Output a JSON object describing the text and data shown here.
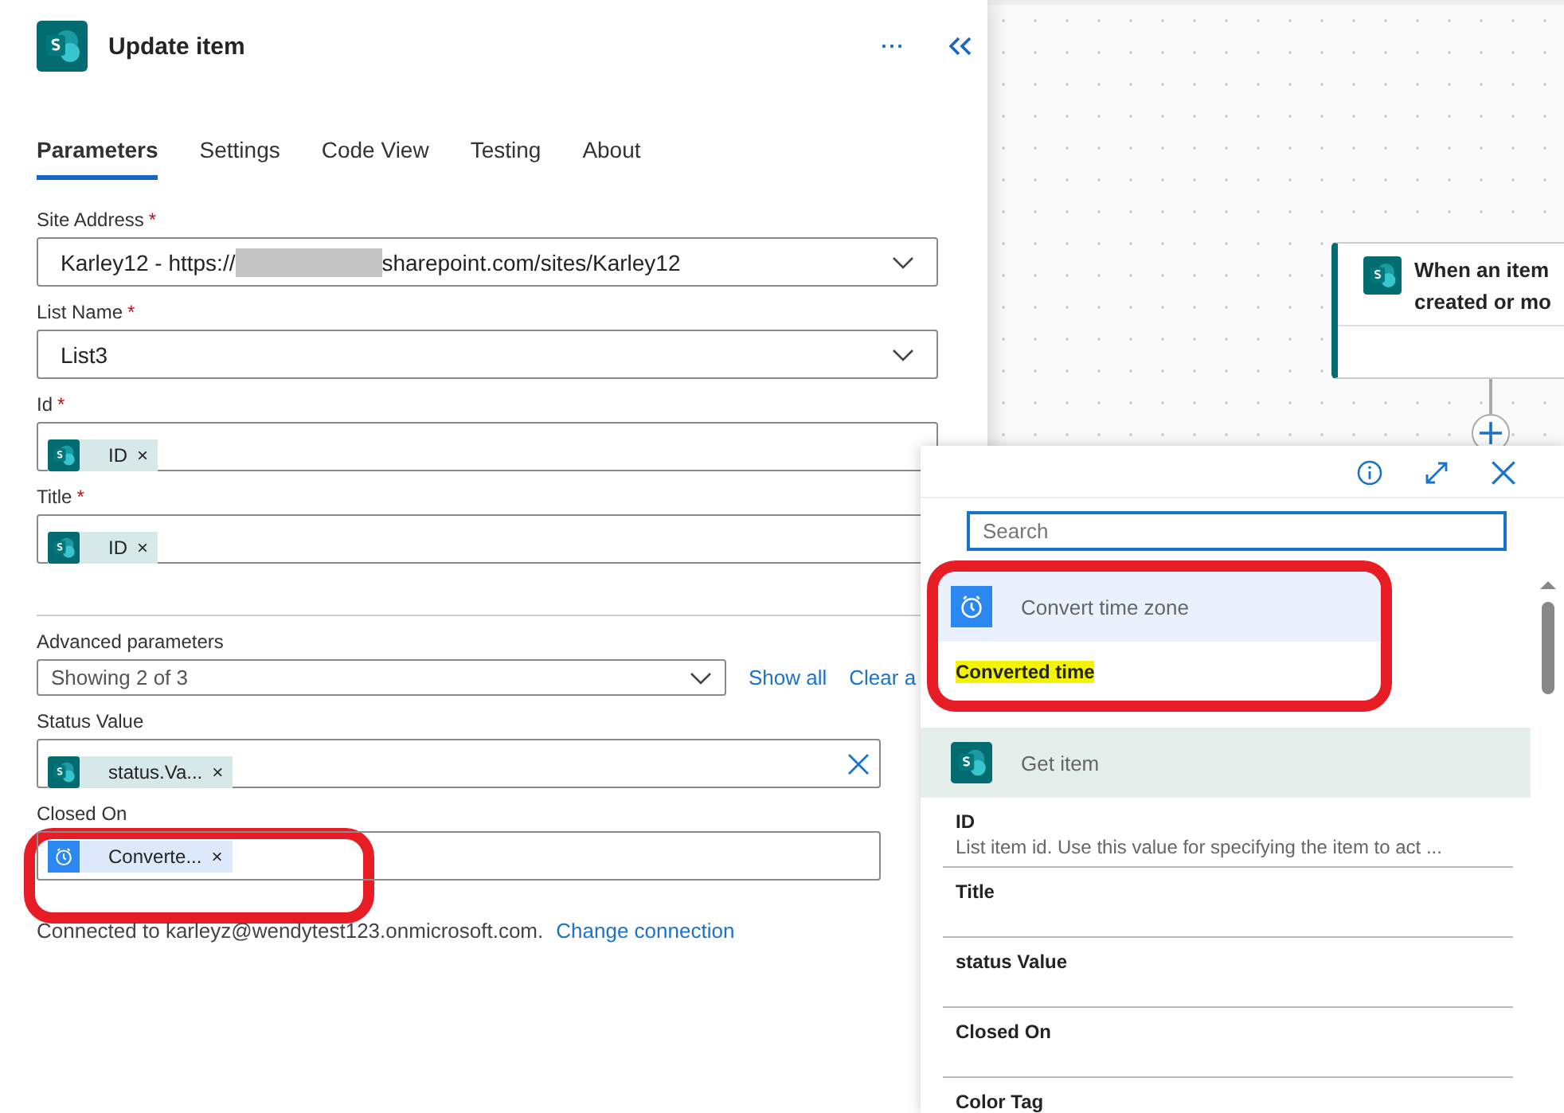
{
  "panel": {
    "title": "Update item",
    "tabs": [
      {
        "label": "Parameters",
        "selected": true
      },
      {
        "label": "Settings",
        "selected": false
      },
      {
        "label": "Code View",
        "selected": false
      },
      {
        "label": "Testing",
        "selected": false
      },
      {
        "label": "About",
        "selected": false
      }
    ],
    "fields": [
      {
        "label": "Site Address",
        "mark": "*",
        "kind": "dropdown",
        "value_start": "Karley12 - https://",
        "redacted": true,
        "value_end": "sharepoint.com/sites/Karley12"
      },
      {
        "label": "List Name",
        "mark": "*",
        "kind": "dropdown",
        "value_start": "List3",
        "redacted": false
      },
      {
        "label": "Id",
        "mark": "*",
        "kind": "tokens",
        "token": {
          "kind": "list",
          "text": "ID",
          "remove": "×"
        }
      },
      {
        "label": "Title",
        "mark": "*",
        "kind": "tokens",
        "token": {
          "kind": "list",
          "text": "ID",
          "remove": "×"
        }
      }
    ],
    "advanced": {
      "label": "Advanced parameters",
      "value": "Showing 2 of 3",
      "show_all": "Show all",
      "clear": "Clear a"
    },
    "extra_fields": [
      {
        "label": "Status Value",
        "clearable": true,
        "token": {
          "kind": "list",
          "text": "status.Va...",
          "remove": "×"
        }
      },
      {
        "label": "Closed On",
        "clearable": false,
        "token": {
          "kind": "time",
          "text": "Converte...",
          "remove": "×"
        }
      }
    ],
    "connection": {
      "text": "Connected to karleyz@wendytest123.onmicrosoft.com.",
      "link": "Change connection"
    }
  },
  "canvas": {
    "trigger": {
      "line1": "When an item",
      "line2": "created or mo"
    }
  },
  "picker": {
    "search": {
      "placeholder": "Search"
    },
    "groups": [
      {
        "kind": "time",
        "title": "Convert time zone",
        "items": [
          {
            "name": "Converted time",
            "highlighted": true
          }
        ]
      },
      {
        "kind": "list",
        "title": "Get item",
        "items": [
          {
            "name": "ID",
            "highlighted": false,
            "description": "List item id. Use this value for specifying the item to act ..."
          },
          {
            "name": "Title",
            "highlighted": false
          },
          {
            "name": "status Value",
            "highlighted": false
          },
          {
            "name": "Closed On",
            "highlighted": false
          },
          {
            "name": "Color Tag",
            "highlighted": false
          }
        ]
      }
    ]
  }
}
